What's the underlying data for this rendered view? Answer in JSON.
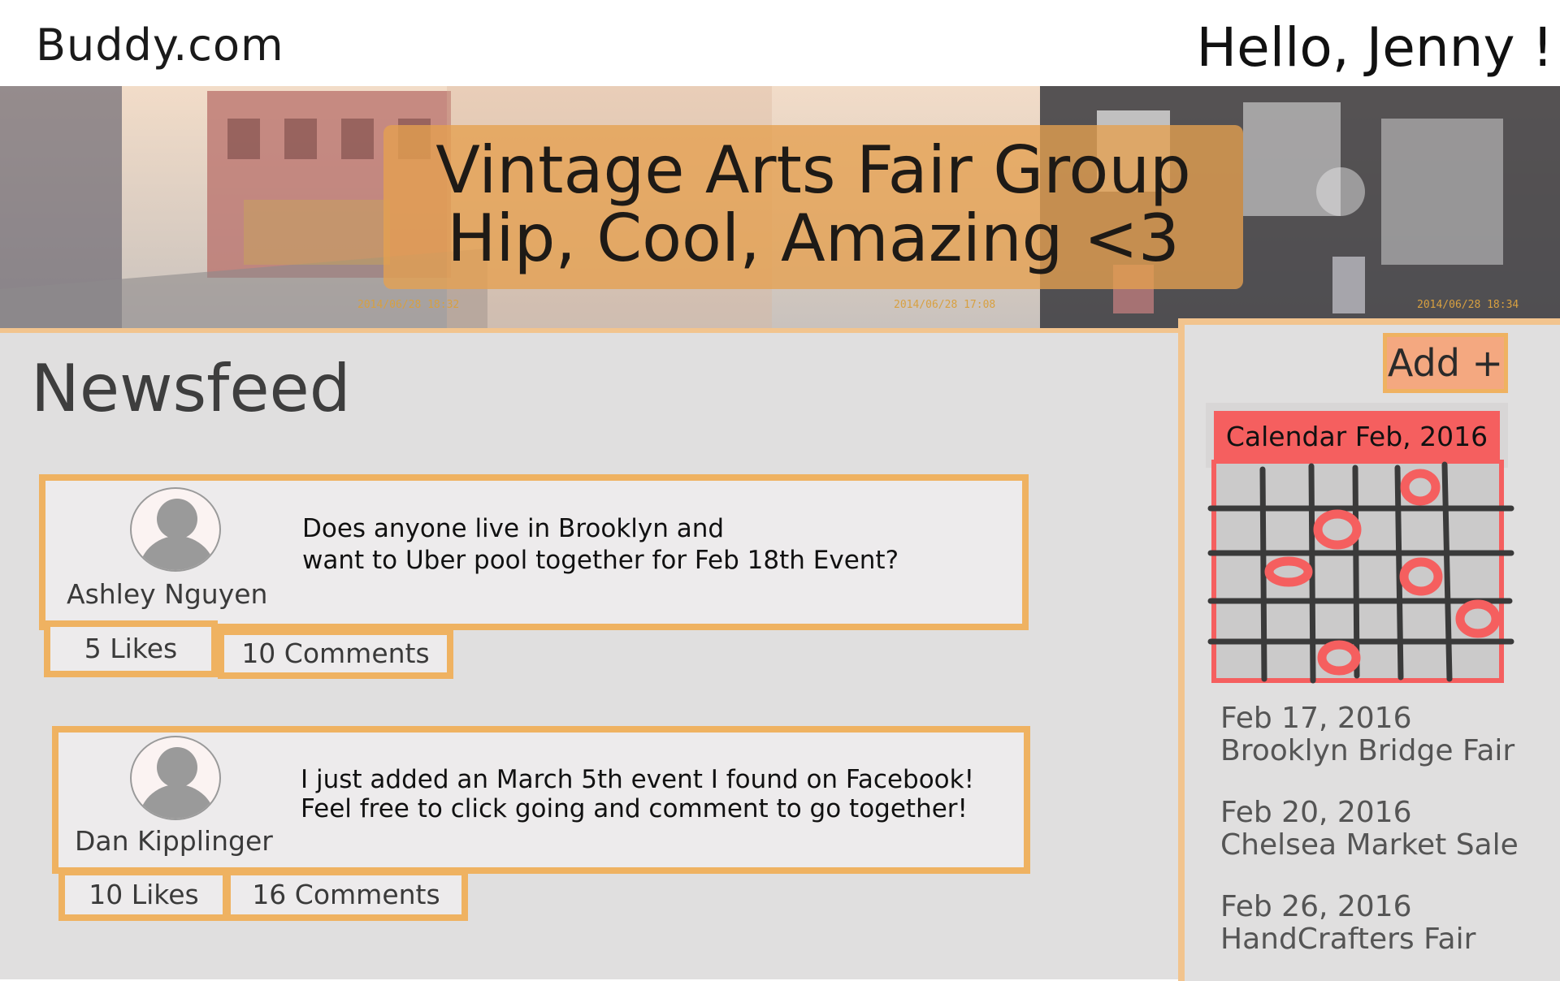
{
  "header": {
    "brand": "Buddy.com",
    "greeting": "Hello, Jenny !"
  },
  "banner": {
    "title_line1": "Vintage Arts Fair Group",
    "title_line2": "Hip, Cool, Amazing <3",
    "stamps": [
      "2014/06/28 18:32",
      "2014/06/28 17:08",
      "2014/06/28 18:34"
    ]
  },
  "newsfeed": {
    "title": "Newsfeed",
    "posts": [
      {
        "author": "Ashley Nguyen",
        "text_line1": "Does anyone live in Brooklyn and",
        "text_line2": "want to Uber pool together for Feb 18th Event?",
        "likes": "5 Likes",
        "comments": "10 Comments"
      },
      {
        "author": "Dan Kipplinger",
        "text_line1": "I just added an March 5th event I found on Facebook!",
        "text_line2": "Feel free to click going and comment to go together!",
        "likes": "10 Likes",
        "comments": "16 Comments"
      }
    ]
  },
  "sidebar": {
    "add_label": "Add +",
    "calendar_header": "Calendar  Feb, 2016",
    "events": [
      {
        "date": "Feb 17, 2016",
        "name": "Brooklyn Bridge Fair"
      },
      {
        "date": "Feb 20, 2016",
        "name": "Chelsea Market Sale"
      },
      {
        "date": "Feb 26, 2016",
        "name": "HandCrafters Fair"
      }
    ]
  },
  "colors": {
    "accent_orange": "#efb261",
    "calendar_red": "#f55f5f",
    "panel_gray": "#e0dfdf"
  }
}
